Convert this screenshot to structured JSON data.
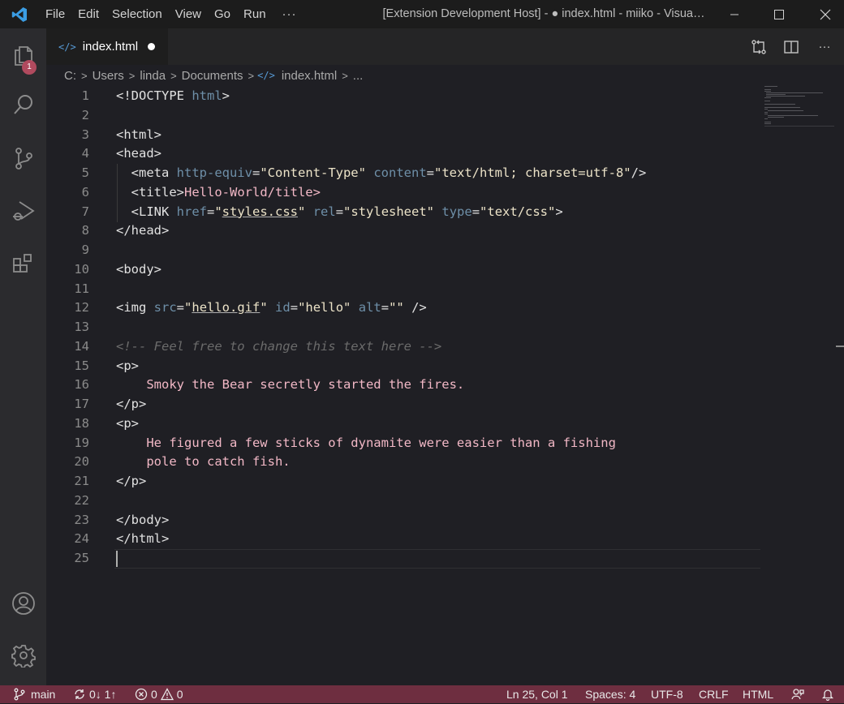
{
  "titlebar": {
    "menu": [
      "File",
      "Edit",
      "Selection",
      "View",
      "Go",
      "Run"
    ],
    "more": "···",
    "title": "[Extension Development Host] - ● index.html - miiko - Visua…"
  },
  "activitybar": {
    "items": [
      "explorer-icon",
      "search-icon",
      "source-control-icon",
      "run-debug-icon",
      "extensions-icon"
    ],
    "explorer_badge": "1",
    "bottom": [
      "account-icon",
      "settings-gear-icon"
    ]
  },
  "tab": {
    "icon": "</>",
    "label": "index.html"
  },
  "breadcrumb": {
    "parts": [
      "C:",
      "Users",
      "linda",
      "Documents"
    ],
    "file_icon": "</>",
    "file": "index.html",
    "tail": "..."
  },
  "editor": {
    "line_numbers": [
      "1",
      "2",
      "3",
      "4",
      "5",
      "6",
      "7",
      "8",
      "9",
      "10",
      "11",
      "12",
      "13",
      "14",
      "15",
      "16",
      "17",
      "18",
      "19",
      "20",
      "21",
      "22",
      "23",
      "24",
      "25"
    ],
    "lines": [
      [
        [
          "tag",
          "<!DOCTYPE "
        ],
        [
          "attr",
          "html"
        ],
        [
          "tag",
          ">"
        ]
      ],
      [],
      [
        [
          "tag",
          "<html>"
        ]
      ],
      [
        [
          "tag",
          "<head>"
        ]
      ],
      [
        [
          "tag",
          "  <meta "
        ],
        [
          "attr",
          "http-equiv"
        ],
        [
          "tag",
          "="
        ],
        [
          "str",
          "\"Content-Type\""
        ],
        [
          "tag",
          " "
        ],
        [
          "attr",
          "content"
        ],
        [
          "tag",
          "="
        ],
        [
          "str",
          "\"text/html; charset=utf-8\""
        ],
        [
          "tag",
          "/>"
        ]
      ],
      [
        [
          "tag",
          "  <title>"
        ],
        [
          "text",
          "Hello-World/title>"
        ]
      ],
      [
        [
          "tag",
          "  <LINK "
        ],
        [
          "attr",
          "href"
        ],
        [
          "tag",
          "="
        ],
        [
          "str",
          "\""
        ],
        [
          "link",
          "styles.css"
        ],
        [
          "str",
          "\""
        ],
        [
          "tag",
          " "
        ],
        [
          "attr",
          "rel"
        ],
        [
          "tag",
          "="
        ],
        [
          "str",
          "\"stylesheet\""
        ],
        [
          "tag",
          " "
        ],
        [
          "attr",
          "type"
        ],
        [
          "tag",
          "="
        ],
        [
          "str",
          "\"text/css\""
        ],
        [
          "tag",
          ">"
        ]
      ],
      [
        [
          "tag",
          "</head>"
        ]
      ],
      [],
      [
        [
          "tag",
          "<body>"
        ]
      ],
      [],
      [
        [
          "tag",
          "<img "
        ],
        [
          "attr",
          "src"
        ],
        [
          "tag",
          "="
        ],
        [
          "str",
          "\""
        ],
        [
          "link",
          "hello.gif"
        ],
        [
          "str",
          "\""
        ],
        [
          "tag",
          " "
        ],
        [
          "attr",
          "id"
        ],
        [
          "tag",
          "="
        ],
        [
          "str",
          "\"hello\""
        ],
        [
          "tag",
          " "
        ],
        [
          "attr",
          "alt"
        ],
        [
          "tag",
          "="
        ],
        [
          "str",
          "\"\""
        ],
        [
          "tag",
          " />"
        ]
      ],
      [],
      [
        [
          "comment",
          "<!-- Feel free to change this text here -->"
        ]
      ],
      [
        [
          "tag",
          "<p>"
        ]
      ],
      [
        [
          "text",
          "    Smoky the Bear secretly started the fires."
        ]
      ],
      [
        [
          "tag",
          "</p>"
        ]
      ],
      [
        [
          "tag",
          "<p>"
        ]
      ],
      [
        [
          "text",
          "    He figured a few sticks of dynamite were easier than a fishing"
        ]
      ],
      [
        [
          "text",
          "    pole to catch fish."
        ]
      ],
      [
        [
          "tag",
          "</p>"
        ]
      ],
      [],
      [
        [
          "tag",
          "</body>"
        ]
      ],
      [
        [
          "tag",
          "</html>"
        ]
      ],
      []
    ]
  },
  "statusbar": {
    "branch": "main",
    "sync": "0↓ 1↑",
    "errors": "0",
    "warnings": "0",
    "position": "Ln 25, Col 1",
    "spaces": "Spaces: 4",
    "encoding": "UTF-8",
    "eol": "CRLF",
    "language": "HTML"
  }
}
